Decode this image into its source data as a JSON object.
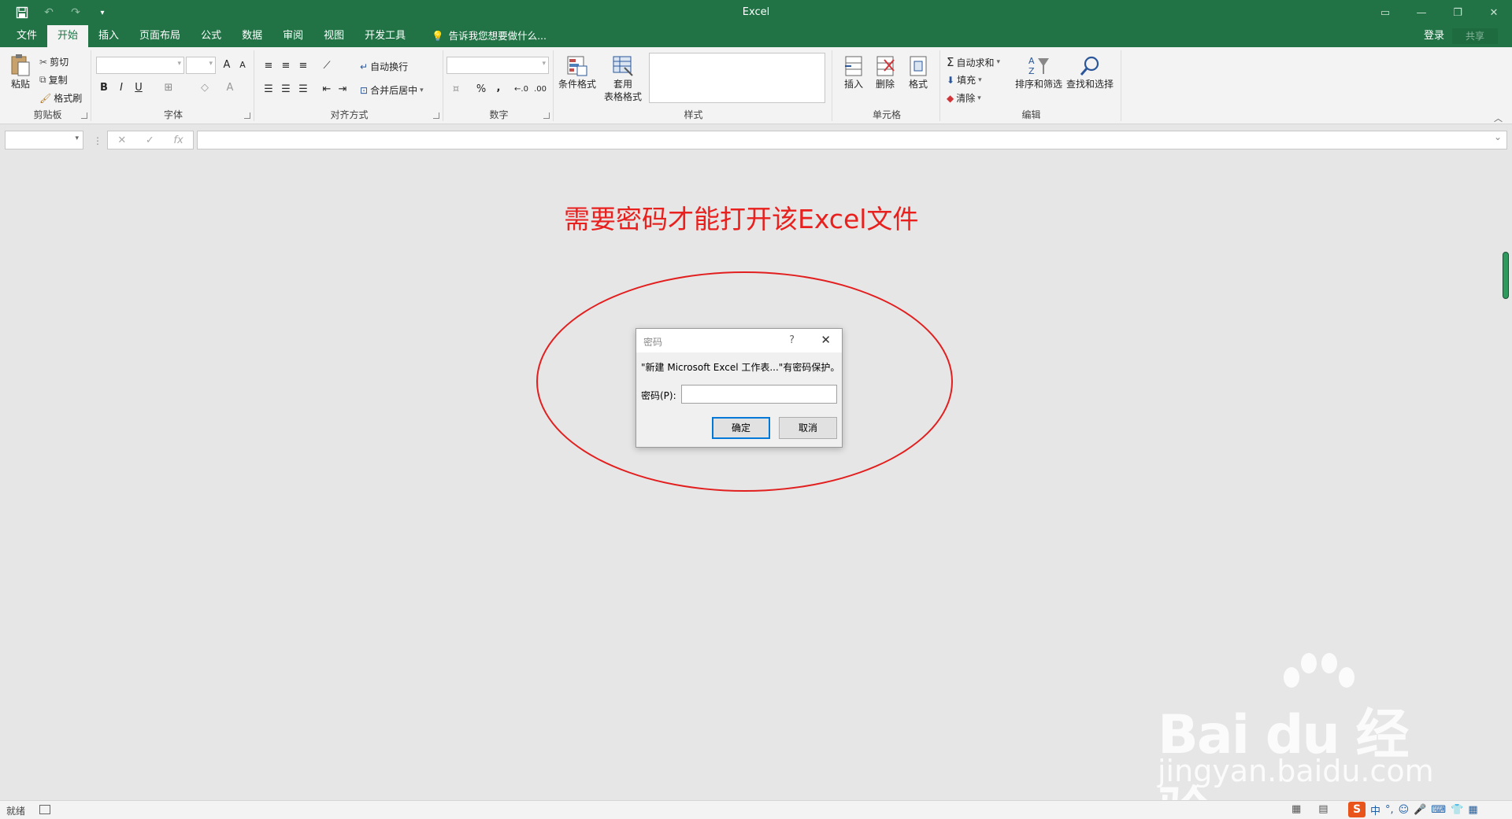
{
  "window": {
    "title": "Excel",
    "login": "登录",
    "share": "共享"
  },
  "tabs": [
    "文件",
    "开始",
    "插入",
    "页面布局",
    "公式",
    "数据",
    "审阅",
    "视图",
    "开发工具"
  ],
  "tell_me": "告诉我您想要做什么...",
  "ribbon": {
    "clipboard": {
      "paste": "粘贴",
      "cut": "剪切",
      "copy": "复制",
      "format_painter": "格式刷",
      "label": "剪贴板"
    },
    "font": {
      "bold": "B",
      "italic": "I",
      "underline": "U",
      "grow": "A",
      "shrink": "A",
      "label": "字体"
    },
    "alignment": {
      "wrap": "自动换行",
      "merge": "合并后居中",
      "label": "对齐方式"
    },
    "number": {
      "percent": "%",
      "comma": ",",
      "inc": "←.0",
      "dec": ".00",
      "label": "数字"
    },
    "styles": {
      "conditional": "条件格式",
      "table_format_1": "套用",
      "table_format_2": "表格格式",
      "label": "样式"
    },
    "cells": {
      "insert": "插入",
      "delete": "删除",
      "format": "格式",
      "label": "单元格"
    },
    "editing": {
      "autosum": "自动求和",
      "fill": "填充",
      "clear": "清除",
      "sort": "排序和筛选",
      "find": "查找和选择",
      "label": "编辑"
    }
  },
  "formula_bar": {
    "fx": "fx"
  },
  "annotation": "需要密码才能打开该Excel文件",
  "dialog": {
    "title": "密码",
    "help": "?",
    "close": "✕",
    "message": "\"新建 Microsoft Excel 工作表...\"有密码保护。",
    "label": "密码(P):",
    "ok": "确定",
    "cancel": "取消"
  },
  "watermark": {
    "brand": "Bai du 经验",
    "site": "jingyan.baidu.com"
  },
  "status": {
    "ready": "就绪",
    "ime": "中"
  },
  "colors": {
    "accent": "#217346",
    "annotation": "#e8201e",
    "dialog_focus": "#0078d7"
  }
}
